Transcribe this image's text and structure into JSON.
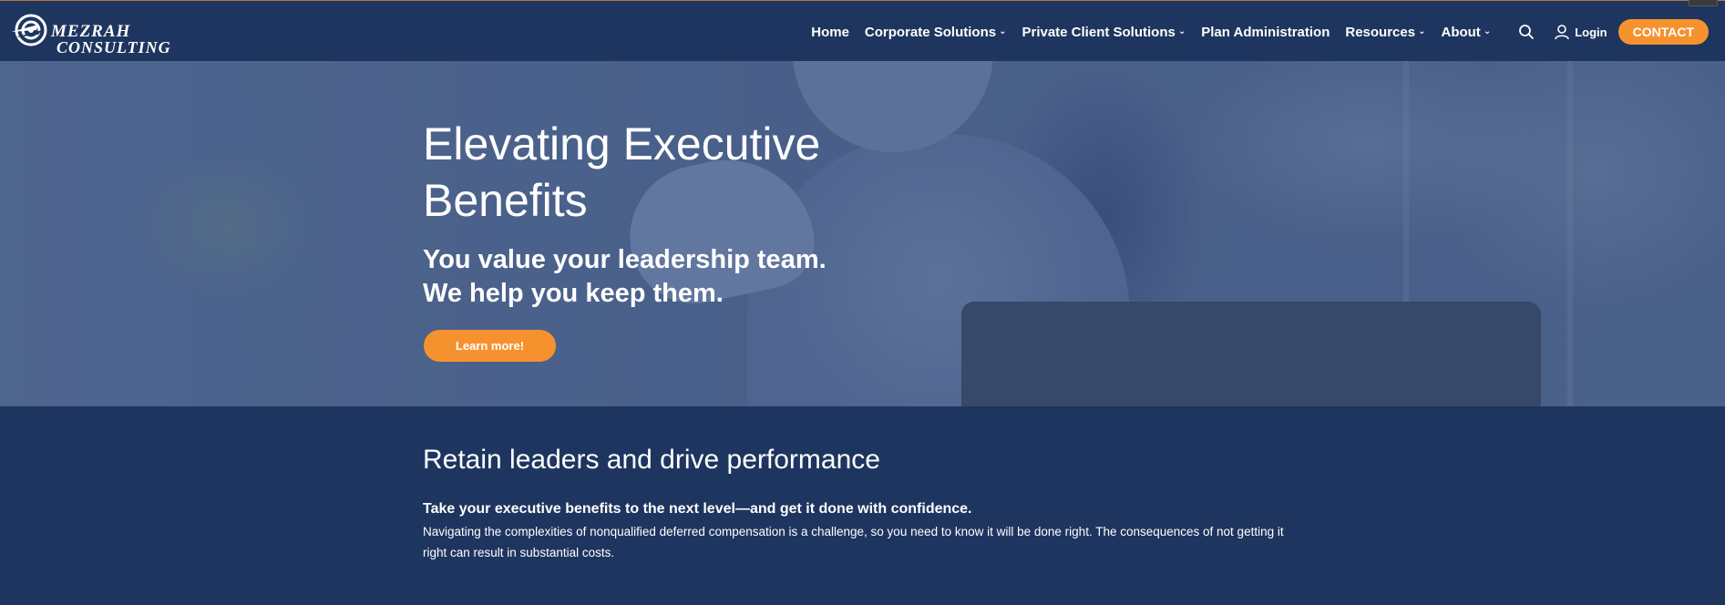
{
  "brand": {
    "name_line1": "MEZRAH",
    "name_line2": "CONSULTING"
  },
  "nav": {
    "items": [
      {
        "label": "Home",
        "has_dropdown": false
      },
      {
        "label": "Corporate Solutions",
        "has_dropdown": true
      },
      {
        "label": "Private Client Solutions",
        "has_dropdown": true
      },
      {
        "label": "Plan Administration",
        "has_dropdown": false
      },
      {
        "label": "Resources",
        "has_dropdown": true
      },
      {
        "label": "About",
        "has_dropdown": true
      }
    ],
    "search_icon": "search-icon",
    "login_label": "Login",
    "contact_label": "CONTACT"
  },
  "hero": {
    "title": "Elevating Executive Benefits",
    "subtitle_line1": "You value your leadership team.",
    "subtitle_line2": "We help you keep them.",
    "cta_label": "Learn more!"
  },
  "section": {
    "title": "Retain leaders and drive performance",
    "lead": "Take your executive benefits to the next level—and get it done with confidence.",
    "body": "Navigating the complexities of nonqualified deferred compensation is a challenge, so you need to know it will be done right. The consequences of not getting it right can result in substantial costs."
  },
  "colors": {
    "navy": "#1e355f",
    "accent_orange": "#f6922e",
    "hero_tint": "#5a7097"
  }
}
